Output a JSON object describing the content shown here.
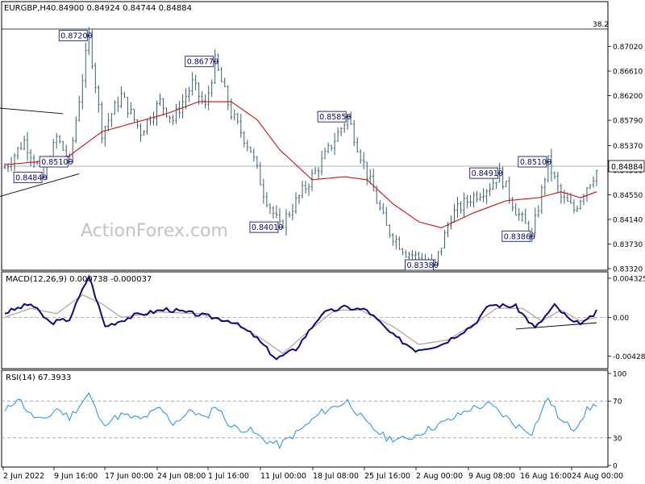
{
  "chart_data": {
    "type": "line",
    "header": {
      "symbol": "EURGBP,H4",
      "ohlc": "0.84900 0.84924 0.84744 0.84884"
    },
    "watermark": "ActionForex.com",
    "price_panel": {
      "ylim": [
        0.8332,
        0.8735
      ],
      "y_ticks": [
        "0.87020",
        "0.86610",
        "0.86200",
        "0.85790",
        "0.85370",
        "0.84960",
        "0.84550",
        "0.84140",
        "0.83730",
        "0.83320"
      ],
      "current_price": "0.84884",
      "fib_line": {
        "label": "38.2",
        "value": 0.8702
      },
      "labels": [
        {
          "text": "0.87200",
          "value": 0.872,
          "index": 26
        },
        {
          "text": "0.86770",
          "value": 0.8677,
          "index": 65
        },
        {
          "text": "0.85850",
          "value": 0.8585,
          "index": 106
        },
        {
          "text": "0.85100",
          "value": 0.851,
          "index": 20
        },
        {
          "text": "0.84840",
          "value": 0.8484,
          "index": 12
        },
        {
          "text": "0.84010",
          "value": 0.8401,
          "index": 85
        },
        {
          "text": "0.83380",
          "value": 0.8338,
          "index": 133
        },
        {
          "text": "0.84910",
          "value": 0.8491,
          "index": 153
        },
        {
          "text": "0.85100",
          "value": 0.851,
          "index": 168
        },
        {
          "text": "0.83860",
          "value": 0.8386,
          "index": 163
        }
      ],
      "pivots": [
        [
          0,
          0.85
        ],
        [
          6,
          0.8545
        ],
        [
          12,
          0.8484
        ],
        [
          16,
          0.855
        ],
        [
          20,
          0.851
        ],
        [
          26,
          0.872
        ],
        [
          30,
          0.856
        ],
        [
          36,
          0.862
        ],
        [
          42,
          0.856
        ],
        [
          48,
          0.861
        ],
        [
          52,
          0.858
        ],
        [
          58,
          0.864
        ],
        [
          62,
          0.86
        ],
        [
          65,
          0.8677
        ],
        [
          70,
          0.859
        ],
        [
          76,
          0.853
        ],
        [
          80,
          0.846
        ],
        [
          85,
          0.8401
        ],
        [
          92,
          0.846
        ],
        [
          98,
          0.851
        ],
        [
          106,
          0.8585
        ],
        [
          112,
          0.849
        ],
        [
          118,
          0.84
        ],
        [
          124,
          0.836
        ],
        [
          133,
          0.8338
        ],
        [
          138,
          0.842
        ],
        [
          144,
          0.845
        ],
        [
          150,
          0.847
        ],
        [
          153,
          0.8491
        ],
        [
          158,
          0.843
        ],
        [
          163,
          0.8386
        ],
        [
          168,
          0.851
        ],
        [
          172,
          0.845
        ],
        [
          176,
          0.843
        ],
        [
          180,
          0.847
        ],
        [
          183,
          0.8495
        ]
      ],
      "ma_pivots": [
        [
          0,
          0.8505
        ],
        [
          10,
          0.851
        ],
        [
          20,
          0.852
        ],
        [
          30,
          0.856
        ],
        [
          40,
          0.8575
        ],
        [
          50,
          0.859
        ],
        [
          60,
          0.861
        ],
        [
          70,
          0.861
        ],
        [
          78,
          0.858
        ],
        [
          85,
          0.853
        ],
        [
          95,
          0.848
        ],
        [
          105,
          0.8485
        ],
        [
          112,
          0.848
        ],
        [
          120,
          0.844
        ],
        [
          128,
          0.841
        ],
        [
          135,
          0.84
        ],
        [
          145,
          0.8425
        ],
        [
          155,
          0.8445
        ],
        [
          165,
          0.845
        ],
        [
          172,
          0.846
        ],
        [
          178,
          0.845
        ],
        [
          183,
          0.846
        ]
      ],
      "triangle_lines": [
        [
          [
            -3,
            0.86
          ],
          [
            18,
            0.859
          ]
        ],
        [
          [
            -3,
            0.845
          ],
          [
            23,
            0.849
          ]
        ]
      ]
    },
    "macd_panel": {
      "label": "MACD(12,26,9) 0.000738 -0.000037",
      "ylim": [
        -0.0055,
        0.0045
      ],
      "y_ticks": [
        "0.004325",
        "0.00",
        "-0.004288"
      ],
      "zero_value": 0.0,
      "pivots": [
        [
          0,
          0.0005
        ],
        [
          8,
          0.0015
        ],
        [
          14,
          -0.0006
        ],
        [
          20,
          -0.0002
        ],
        [
          26,
          0.0046
        ],
        [
          31,
          -0.001
        ],
        [
          40,
          0.0002
        ],
        [
          50,
          0.0009
        ],
        [
          60,
          0.0003
        ],
        [
          70,
          -0.0004
        ],
        [
          77,
          -0.002
        ],
        [
          84,
          -0.0046
        ],
        [
          90,
          -0.0035
        ],
        [
          98,
          0.0004
        ],
        [
          105,
          0.0011
        ],
        [
          112,
          0.0008
        ],
        [
          120,
          -0.002
        ],
        [
          127,
          -0.0036
        ],
        [
          135,
          -0.003
        ],
        [
          145,
          -0.0008
        ],
        [
          150,
          0.0014
        ],
        [
          158,
          0.0012
        ],
        [
          164,
          -0.0012
        ],
        [
          170,
          0.0013
        ],
        [
          176,
          -0.0007
        ],
        [
          180,
          -0.0004
        ],
        [
          183,
          0.0006
        ]
      ],
      "signal_pivots": [
        [
          0,
          0.0
        ],
        [
          8,
          0.001
        ],
        [
          16,
          0.0004
        ],
        [
          24,
          0.0025
        ],
        [
          30,
          0.0015
        ],
        [
          36,
          0.0
        ],
        [
          48,
          0.0006
        ],
        [
          60,
          0.0004
        ],
        [
          72,
          -0.0008
        ],
        [
          80,
          -0.0025
        ],
        [
          86,
          -0.004
        ],
        [
          94,
          -0.0015
        ],
        [
          102,
          0.0008
        ],
        [
          110,
          0.0008
        ],
        [
          120,
          -0.001
        ],
        [
          128,
          -0.003
        ],
        [
          137,
          -0.0025
        ],
        [
          147,
          -0.0003
        ],
        [
          152,
          0.001
        ],
        [
          160,
          0.001
        ],
        [
          166,
          -0.0004
        ],
        [
          172,
          0.0008
        ],
        [
          178,
          -0.0004
        ],
        [
          183,
          0.0
        ]
      ],
      "trend_line": [
        [
          158,
          -0.0013
        ],
        [
          183,
          -0.0006
        ]
      ]
    },
    "rsi_panel": {
      "label": "RSI(14) 67.3933",
      "ylim": [
        0,
        100
      ],
      "y_ticks": [
        "100",
        "70",
        "30",
        "0"
      ],
      "pivots": [
        [
          0,
          58
        ],
        [
          4,
          74
        ],
        [
          8,
          55
        ],
        [
          12,
          48
        ],
        [
          16,
          62
        ],
        [
          20,
          52
        ],
        [
          26,
          78
        ],
        [
          30,
          45
        ],
        [
          36,
          55
        ],
        [
          42,
          50
        ],
        [
          48,
          62
        ],
        [
          52,
          46
        ],
        [
          58,
          60
        ],
        [
          62,
          50
        ],
        [
          65,
          66
        ],
        [
          70,
          42
        ],
        [
          76,
          38
        ],
        [
          80,
          28
        ],
        [
          85,
          22
        ],
        [
          92,
          40
        ],
        [
          98,
          58
        ],
        [
          106,
          70
        ],
        [
          112,
          45
        ],
        [
          118,
          30
        ],
        [
          124,
          28
        ],
        [
          130,
          38
        ],
        [
          138,
          50
        ],
        [
          144,
          62
        ],
        [
          150,
          66
        ],
        [
          154,
          55
        ],
        [
          158,
          44
        ],
        [
          163,
          36
        ],
        [
          168,
          74
        ],
        [
          172,
          48
        ],
        [
          176,
          40
        ],
        [
          180,
          60
        ],
        [
          183,
          67
        ]
      ]
    },
    "x_ticks": [
      "2 Jun 2022",
      "9 Jun 16:00",
      "17 Jun 00:00",
      "24 Jun 08:00",
      "1 Jul 16:00",
      "11 Jul 00:00",
      "18 Jul 08:00",
      "25 Jul 16:00",
      "2 Aug 00:00",
      "9 Aug 08:00",
      "16 Aug 16:00",
      "24 Aug 00:00"
    ],
    "colors": {
      "price": "#3a5f6a",
      "ma": "#cc1111",
      "macd": "#0a0a7a",
      "signal": "#b0a0a0",
      "rsi": "#1e8fe8",
      "label_border": "#1a1a6e",
      "label_text": "#0a0a60",
      "watermark": "#bfc4cc"
    }
  }
}
